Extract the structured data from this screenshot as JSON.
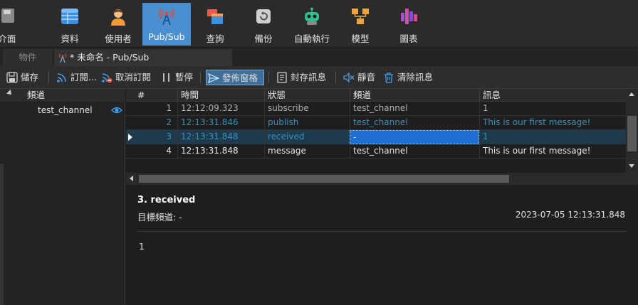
{
  "ribbon": {
    "left_partial_label": "ˌ介面",
    "items": [
      {
        "label": "資料",
        "icon": "table-icon"
      },
      {
        "label": "使用者",
        "icon": "user-icon"
      },
      {
        "label": "Pub/Sub",
        "icon": "broadcast-icon"
      },
      {
        "label": "查詢",
        "icon": "query-icon"
      },
      {
        "label": "備份",
        "icon": "backup-icon"
      },
      {
        "label": "自動執行",
        "icon": "robot-icon"
      },
      {
        "label": "模型",
        "icon": "model-icon"
      },
      {
        "label": "圖表",
        "icon": "chart-icon"
      }
    ],
    "active_index": 2
  },
  "tabs": {
    "objects_label": "物件",
    "pubsub_label": "* 未命名 - Pub/Sub"
  },
  "actions": {
    "save": "儲存",
    "subscribe": "訂閱...",
    "unsubscribe": "取消訂閱",
    "pause": "暫停",
    "publish_window": "發佈窗格",
    "archive": "封存訊息",
    "mute": "靜音",
    "clear": "清除訊息"
  },
  "tree": {
    "header": "頻道",
    "channel": "test_channel"
  },
  "grid": {
    "headers": [
      "#",
      "時間",
      "狀態",
      "頻道",
      "訊息"
    ],
    "rows": [
      {
        "num": "1",
        "time": "12:12:09.323",
        "status": "subscribe",
        "channel": "test_channel",
        "message": "1"
      },
      {
        "num": "2",
        "time": "12:13:31.846",
        "status": "publish",
        "channel": "test_channel",
        "message": "This is our first message!"
      },
      {
        "num": "3",
        "time": "12:13:31.848",
        "status": "received",
        "channel": "-",
        "message": "1"
      },
      {
        "num": "4",
        "time": "12:13:31.848",
        "status": "message",
        "channel": "test_channel",
        "message": "This is our first message!"
      }
    ],
    "selected_row": 3
  },
  "detail": {
    "title": "3.  received",
    "channel_line": "目標頻道:  -",
    "timestamp": "2023-07-05 12:13:31.848",
    "message": "1"
  },
  "colors": {
    "accent": "#4a8fd0",
    "selected_row_text": "#3a8fb8",
    "cell_focus": "#1f6fd0"
  }
}
